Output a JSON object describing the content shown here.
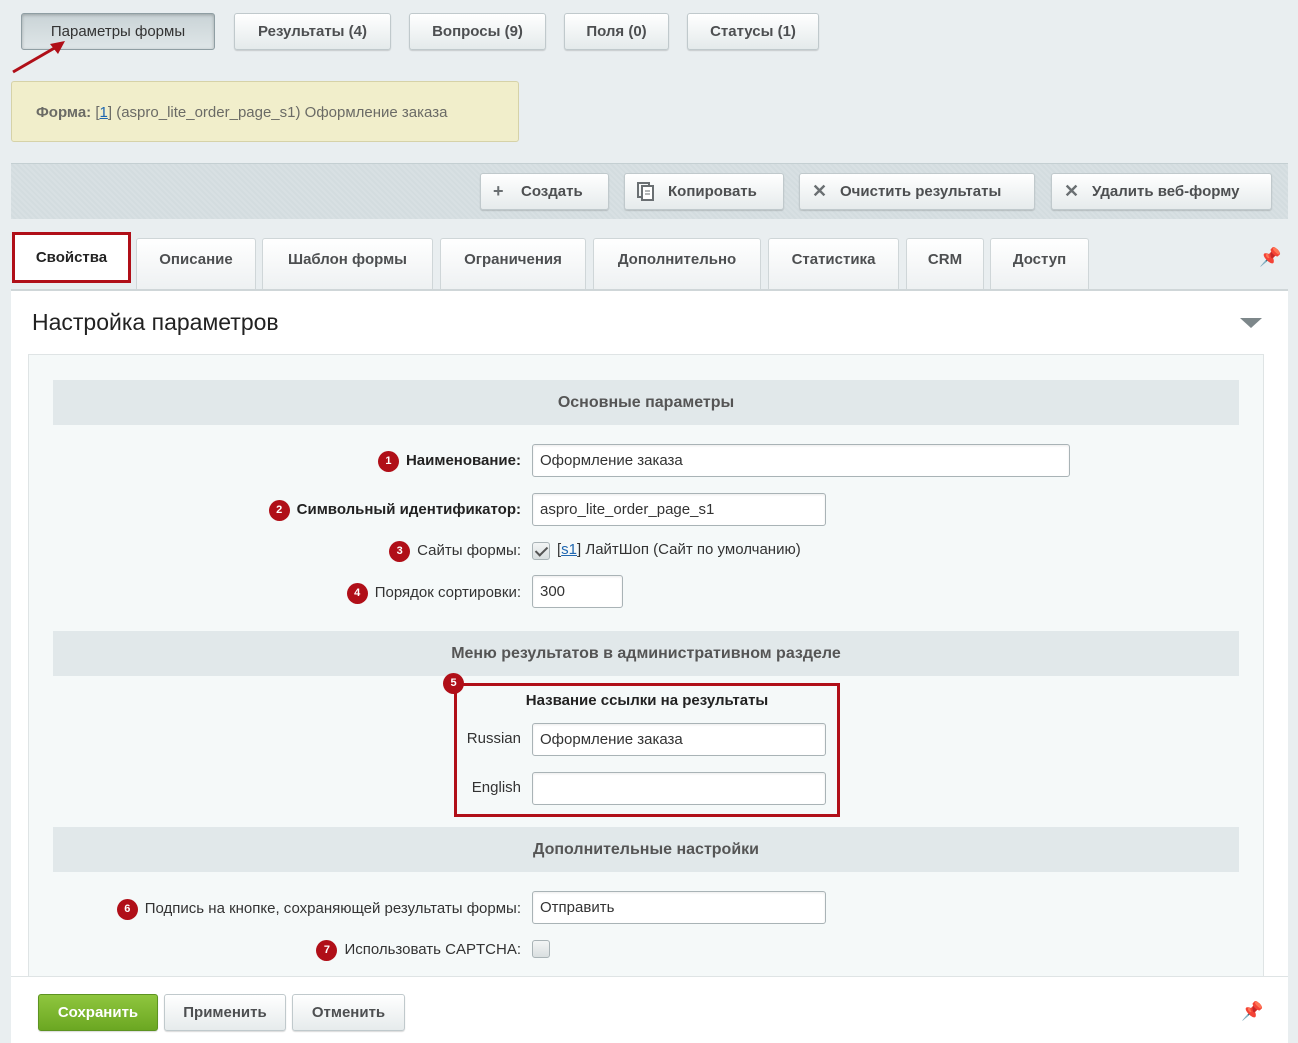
{
  "top_tabs": [
    {
      "label": "Параметры формы"
    },
    {
      "label": "Результаты (4)"
    },
    {
      "label": "Вопросы (9)"
    },
    {
      "label": "Поля (0)"
    },
    {
      "label": "Статусы (1)"
    }
  ],
  "form_info": {
    "prefix": "Форма:",
    "id_link": "1",
    "text": "(aspro_lite_order_page_s1) Оформление заказа"
  },
  "toolbar": {
    "create": "Создать",
    "copy": "Копировать",
    "clear_results": "Очистить результаты",
    "delete_form": "Удалить веб-форму"
  },
  "tabs": [
    {
      "label": "Свойства"
    },
    {
      "label": "Описание"
    },
    {
      "label": "Шаблон формы"
    },
    {
      "label": "Ограничения"
    },
    {
      "label": "Дополнительно"
    },
    {
      "label": "Статистика"
    },
    {
      "label": "CRM"
    },
    {
      "label": "Доступ"
    }
  ],
  "panel": {
    "title": "Настройка параметров",
    "sections": {
      "main": "Основные параметры",
      "menu": "Меню результатов в административном разделе",
      "extra": "Дополнительные настройки"
    },
    "fields": {
      "name": {
        "badge": "1",
        "label": "Наименование:",
        "value": "Оформление заказа"
      },
      "sid": {
        "badge": "2",
        "label": "Символьный идентификатор:",
        "value": "aspro_lite_order_page_s1"
      },
      "sites": {
        "badge": "3",
        "label": "Сайты формы:",
        "site_link": "s1",
        "site_text": "ЛайтШоп (Сайт по умолчанию)",
        "checked": true
      },
      "sort": {
        "badge": "4",
        "label": "Порядок сортировки:",
        "value": "300"
      },
      "link_name": {
        "badge": "5",
        "title": "Название ссылки на результаты",
        "russian_label": "Russian",
        "russian_value": "Оформление заказа",
        "english_label": "English",
        "english_value": ""
      },
      "button_caption": {
        "badge": "6",
        "label": "Подпись на кнопке, сохраняющей результаты формы:",
        "value": "Отправить"
      },
      "captcha": {
        "badge": "7",
        "label": "Использовать CAPTCHA:",
        "checked": false
      }
    }
  },
  "footer": {
    "save": "Сохранить",
    "apply": "Применить",
    "cancel": "Отменить"
  },
  "colors": {
    "accent_red": "#b00f18",
    "save_green": "#7ab62e",
    "link_blue": "#2067b0"
  }
}
